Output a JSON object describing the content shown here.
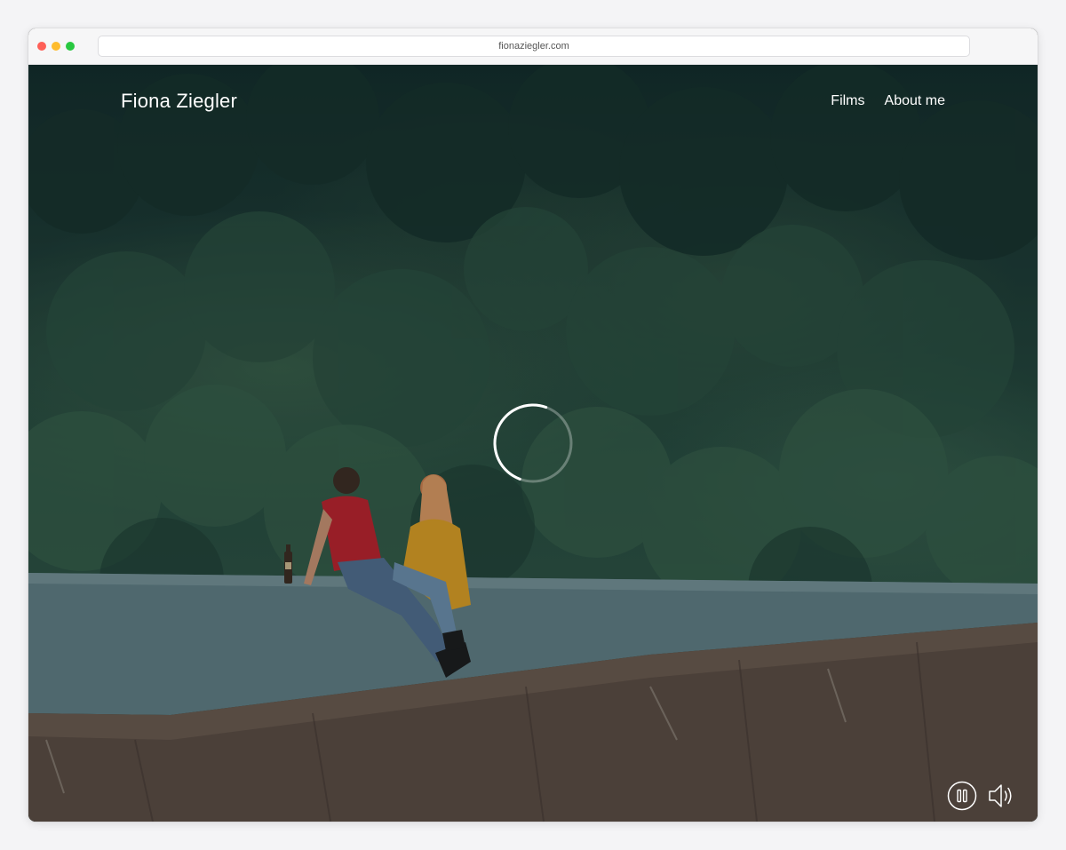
{
  "browser": {
    "url": "fionaziegler.com"
  },
  "site": {
    "brand": "Fiona Ziegler",
    "nav": [
      {
        "label": "Films"
      },
      {
        "label": "About me"
      }
    ]
  },
  "player": {
    "state": "loading",
    "controls": {
      "pause_icon": "pause-icon",
      "sound_icon": "speaker-icon"
    }
  },
  "colors": {
    "text": "#ffffff",
    "chrome_bg": "#f6f6f7",
    "forest": "#1d3a33",
    "concrete": "#5e7b80",
    "shirt_red": "#b8202a",
    "sweater_yellow": "#d79a22"
  }
}
